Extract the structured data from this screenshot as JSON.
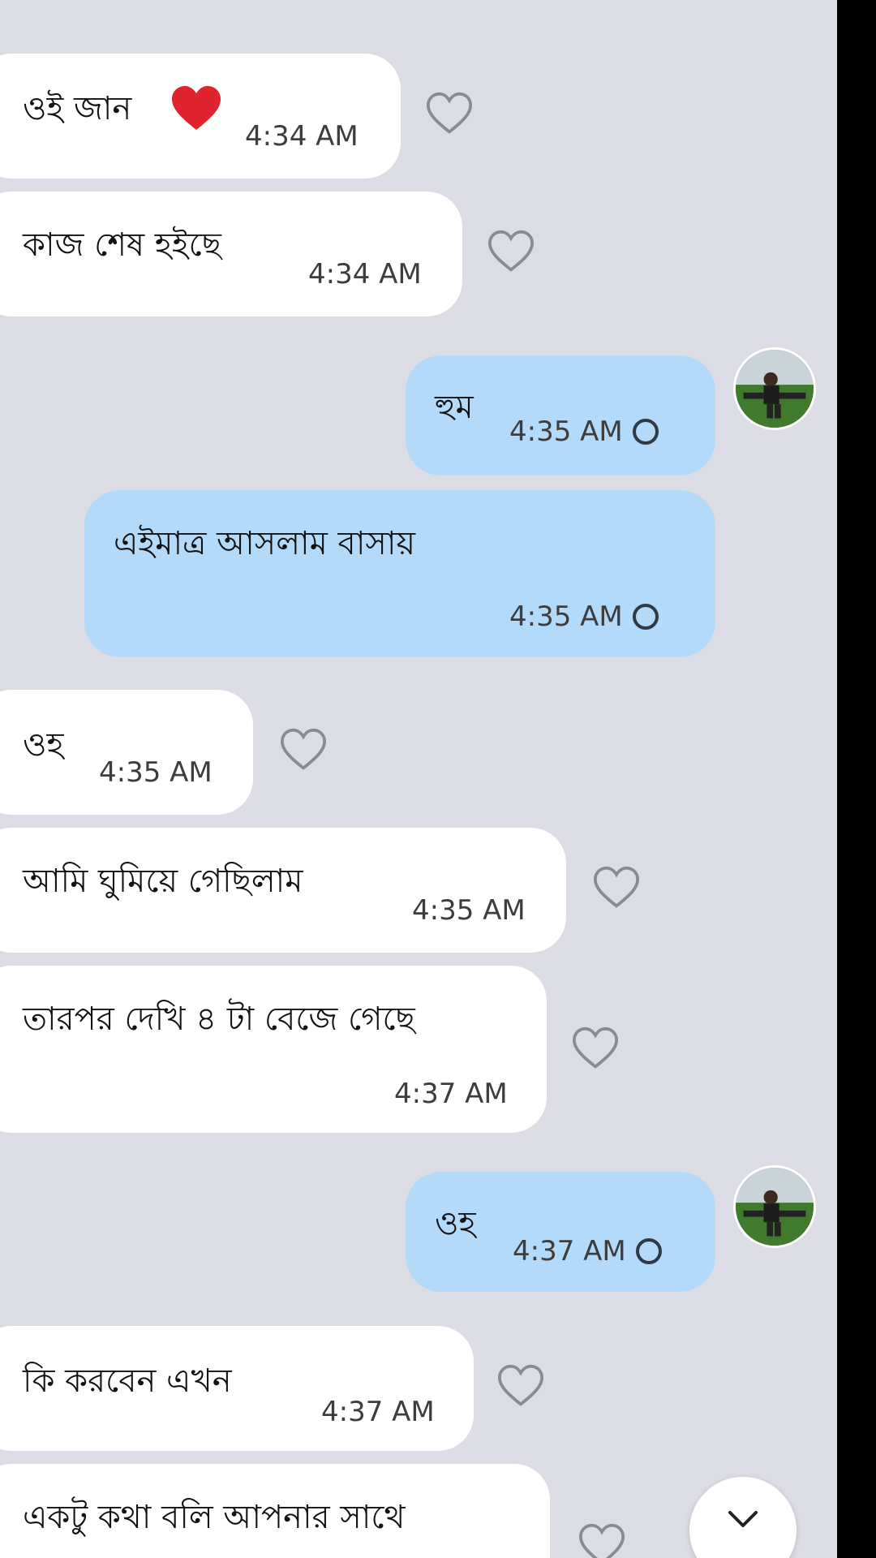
{
  "colors": {
    "background": "#dcdce4",
    "incoming_bubble": "#ffffff",
    "outgoing_bubble": "#b4dafa",
    "text": "#111111",
    "timestamp": "#3d3d3d"
  },
  "messages": [
    {
      "direction": "incoming",
      "text": "ওই জান",
      "emoji": "heart-icon",
      "time": "4:34 AM"
    },
    {
      "direction": "incoming",
      "text": "কাজ শেষ হইছে",
      "time": "4:34 AM"
    },
    {
      "direction": "outgoing",
      "text": "হুম",
      "time": "4:35 AM",
      "status_icon": "sent-circle-icon"
    },
    {
      "direction": "outgoing",
      "text": "এইমাত্র আসলাম বাসায়",
      "time": "4:35 AM",
      "status_icon": "sent-circle-icon"
    },
    {
      "direction": "incoming",
      "text": "ওহ",
      "time": "4:35 AM"
    },
    {
      "direction": "incoming",
      "text": "আমি ঘুমিয়ে গেছিলাম",
      "time": "4:35 AM"
    },
    {
      "direction": "incoming",
      "text": "তারপর দেখি ৪ টা বেজে গেছে",
      "time": "4:37 AM"
    },
    {
      "direction": "outgoing",
      "text": "ওহ",
      "time": "4:37 AM",
      "status_icon": "sent-circle-icon"
    },
    {
      "direction": "incoming",
      "text": "কি করবেন এখন",
      "time": "4:37 AM"
    },
    {
      "direction": "incoming",
      "text": "একটু কথা বলি আপনার সাথে",
      "time": ""
    }
  ],
  "icons": {
    "react": "heart-outline-icon",
    "avatar": "avatar",
    "scroll": "chevron-down-icon"
  }
}
